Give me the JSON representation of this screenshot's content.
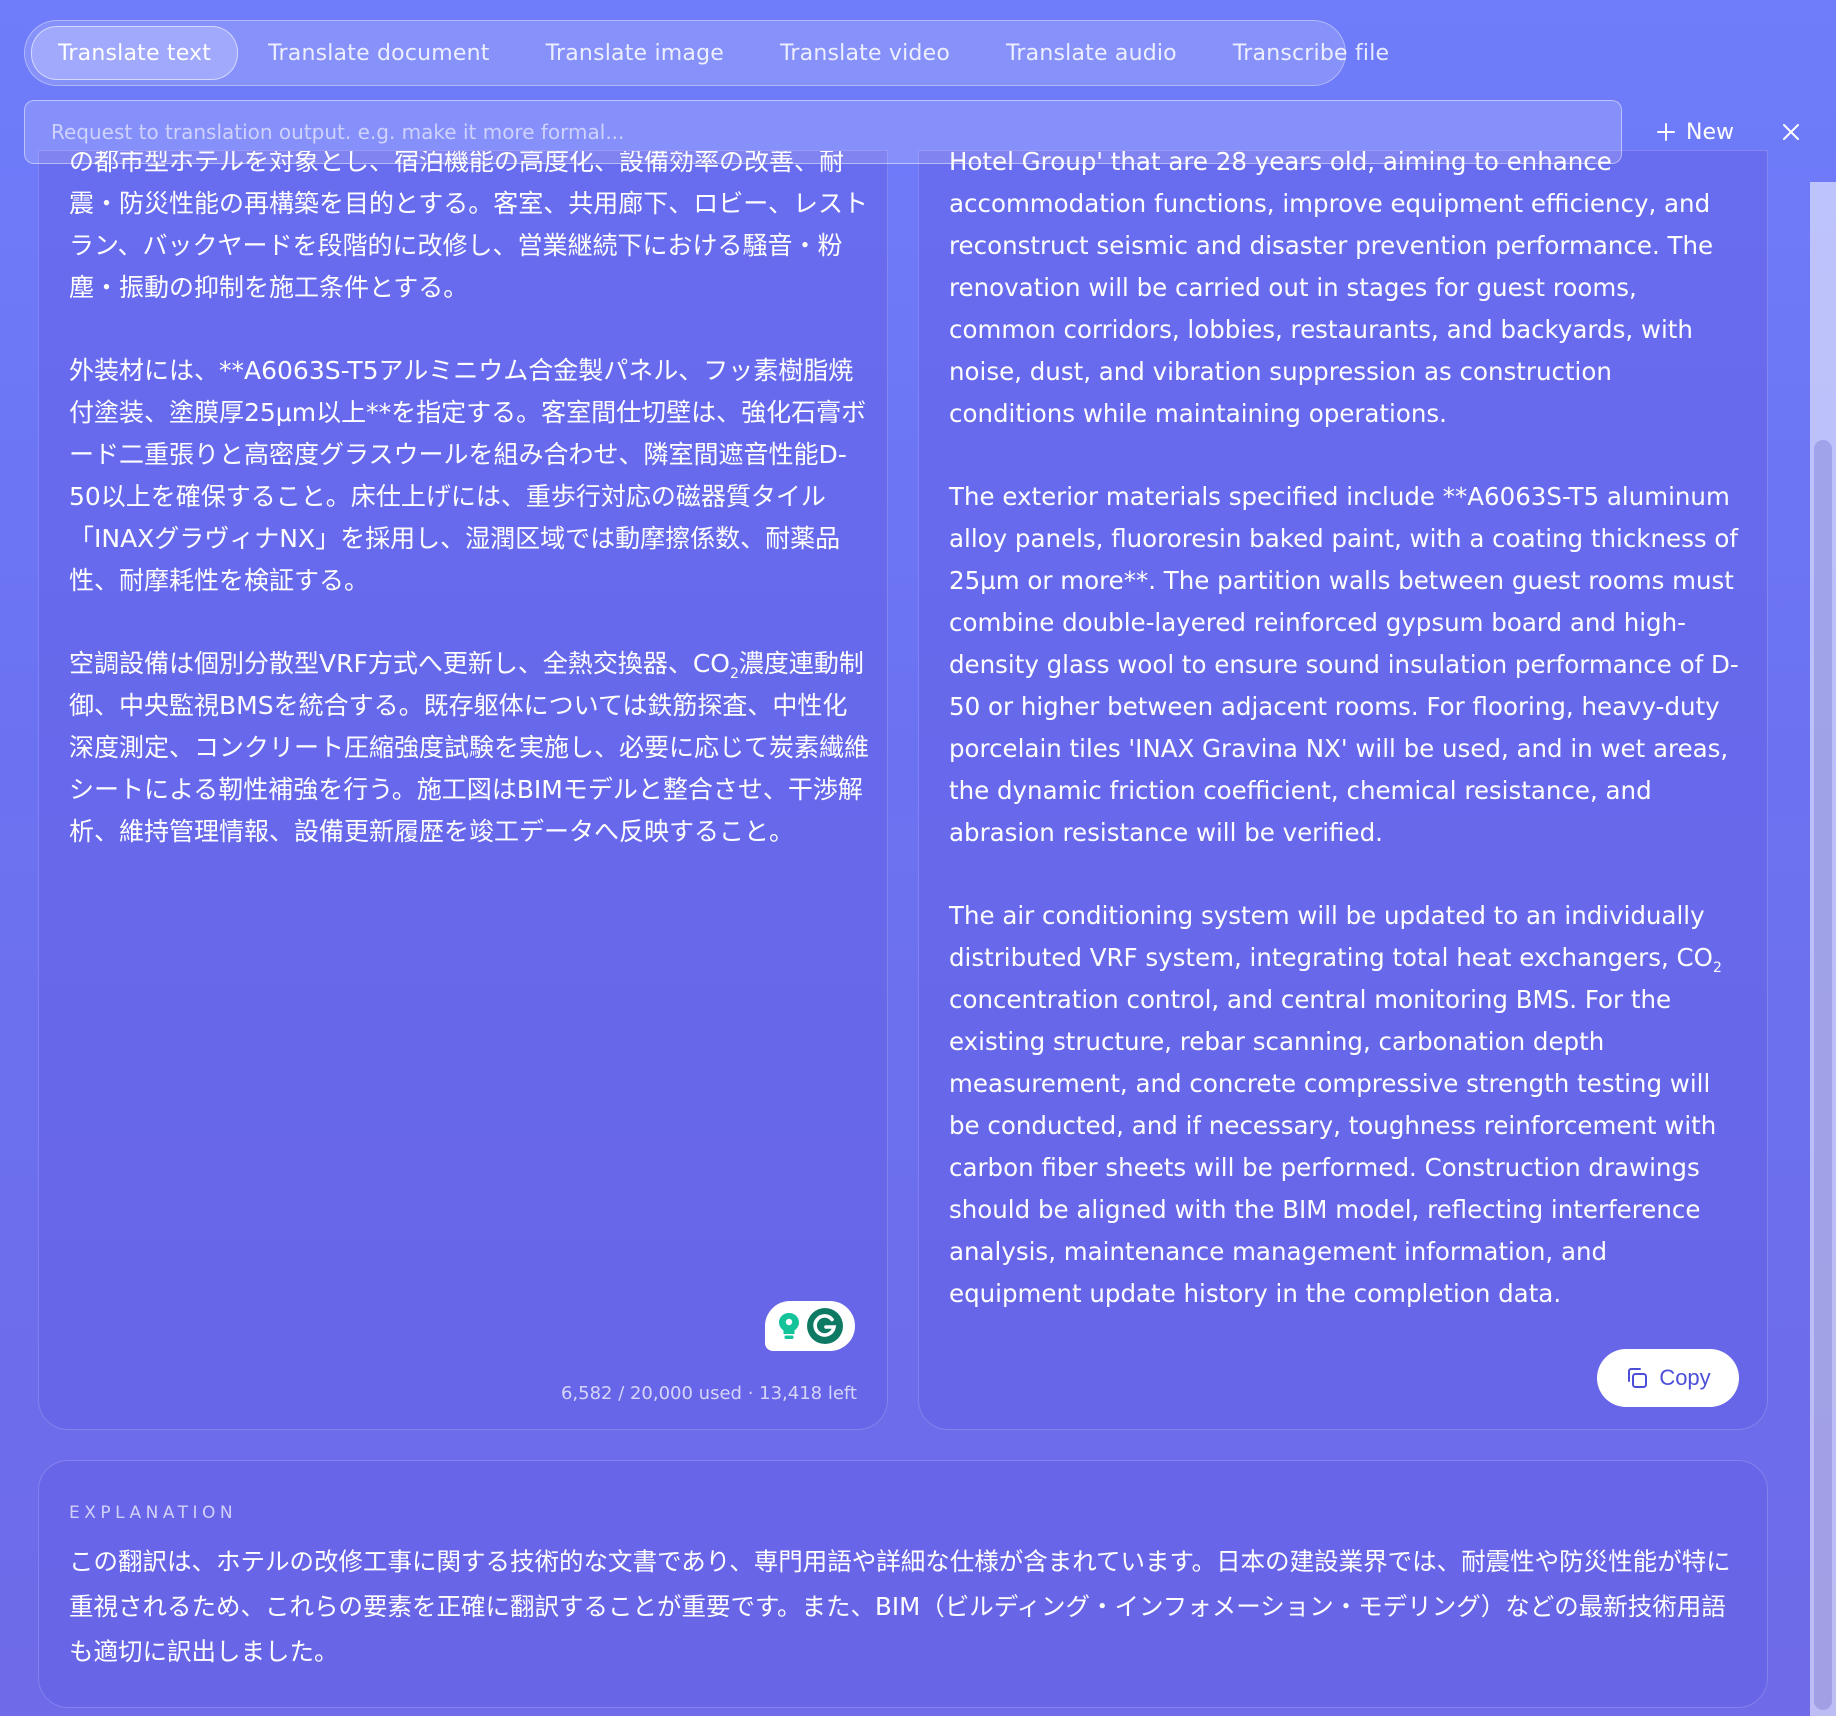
{
  "tabs": [
    {
      "label": "Translate text",
      "active": true
    },
    {
      "label": "Translate document",
      "active": false
    },
    {
      "label": "Translate image",
      "active": false
    },
    {
      "label": "Translate video",
      "active": false
    },
    {
      "label": "Translate audio",
      "active": false
    },
    {
      "label": "Transcribe file",
      "active": false
    }
  ],
  "instruction": {
    "placeholder": "Request to translation output. e.g. make it more formal...",
    "value": ""
  },
  "toolbar": {
    "new_label": "New",
    "new_icon": "plus-icon",
    "close_icon": "close-icon"
  },
  "source": {
    "paragraphs": [
      "の都市型ホテルを対象とし、宿泊機能の高度化、設備効率の改善、耐震・防災性能の再構築を目的とする。客室、共用廊下、ロビー、レストラン、バックヤードを段階的に改修し、営業継続下における騒音・粉塵・振動の抑制を施工条件とする。",
      "外装材には、**A6063S-T5アルミニウム合金製パネル、フッ素樹脂焼付塗装、塗膜厚25μm以上**を指定する。客室間仕切壁は、強化石膏ボード二重張りと高密度グラスウールを組み合わせ、隣室間遮音性能D-50以上を確保すること。床仕上げには、重歩行対応の磁器質タイル「INAXグラヴィナNX」を採用し、湿潤区域では動摩擦係数、耐薬品性、耐摩耗性を検証する。"
    ],
    "p3_before": "空調設備は個別分散型VRF方式へ更新し、全熱交換器、CO",
    "p3_sub": "2",
    "p3_after": "濃度連動制御、中央監視BMSを統合する。既存躯体については鉄筋探査、中性化深度測定、コンクリート圧縮強度試験を実施し、必要に応じて炭素繊維シートによる靭性補強を行う。施工図はBIMモデルと整合させ、干渉解析、維持管理情報、設備更新履歴を竣工データへ反映すること。",
    "usage": "6,582 / 20,000 used · 13,418 left",
    "grammarly_icon": "grammarly-icon"
  },
  "target": {
    "paragraphs": [
      "Hotel Group' that are 28 years old, aiming to enhance accommodation functions, improve equipment efficiency, and reconstruct seismic and disaster prevention performance. The renovation will be carried out in stages for guest rooms, common corridors, lobbies, restaurants, and backyards, with noise, dust, and vibration suppression as construction conditions while maintaining operations.",
      "The exterior materials specified include **A6063S-T5 aluminum alloy panels, fluororesin baked paint, with a coating thickness of 25µm or more**. The partition walls between guest rooms must combine double-layered reinforced gypsum board and high-density glass wool to ensure sound insulation performance of D-50 or higher between adjacent rooms. For flooring, heavy-duty porcelain tiles 'INAX Gravina NX' will be used, and in wet areas, the dynamic friction coefficient, chemical resistance, and abrasion resistance will be verified."
    ],
    "p3_before": "The air conditioning system will be updated to an individually distributed VRF system, integrating total heat exchangers, CO",
    "p3_sub": "2",
    "p3_after": " concentration control, and central monitoring BMS. For the existing structure, rebar scanning, carbonation depth measurement, and concrete compressive strength testing will be conducted, and if necessary, toughness reinforcement with carbon fiber sheets will be performed. Construction drawings should be aligned with the BIM model, reflecting interference analysis, maintenance management information, and equipment update history in the completion data.",
    "copy_label": "Copy",
    "copy_icon": "copy-icon"
  },
  "explanation": {
    "label": "EXPLANATION",
    "text": "この翻訳は、ホテルの改修工事に関する技術的な文書であり、専門用語や詳細な仕様が含まれています。日本の建設業界では、耐震性や防災性能が特に重視されるため、これらの要素を正確に翻訳することが重要です。また、BIM（ビルディング・インフォメーション・モデリング）などの最新技術用語も適切に訳出しました。"
  },
  "colors": {
    "accent": "#4b4fd8",
    "background": "#6f7dfb"
  }
}
